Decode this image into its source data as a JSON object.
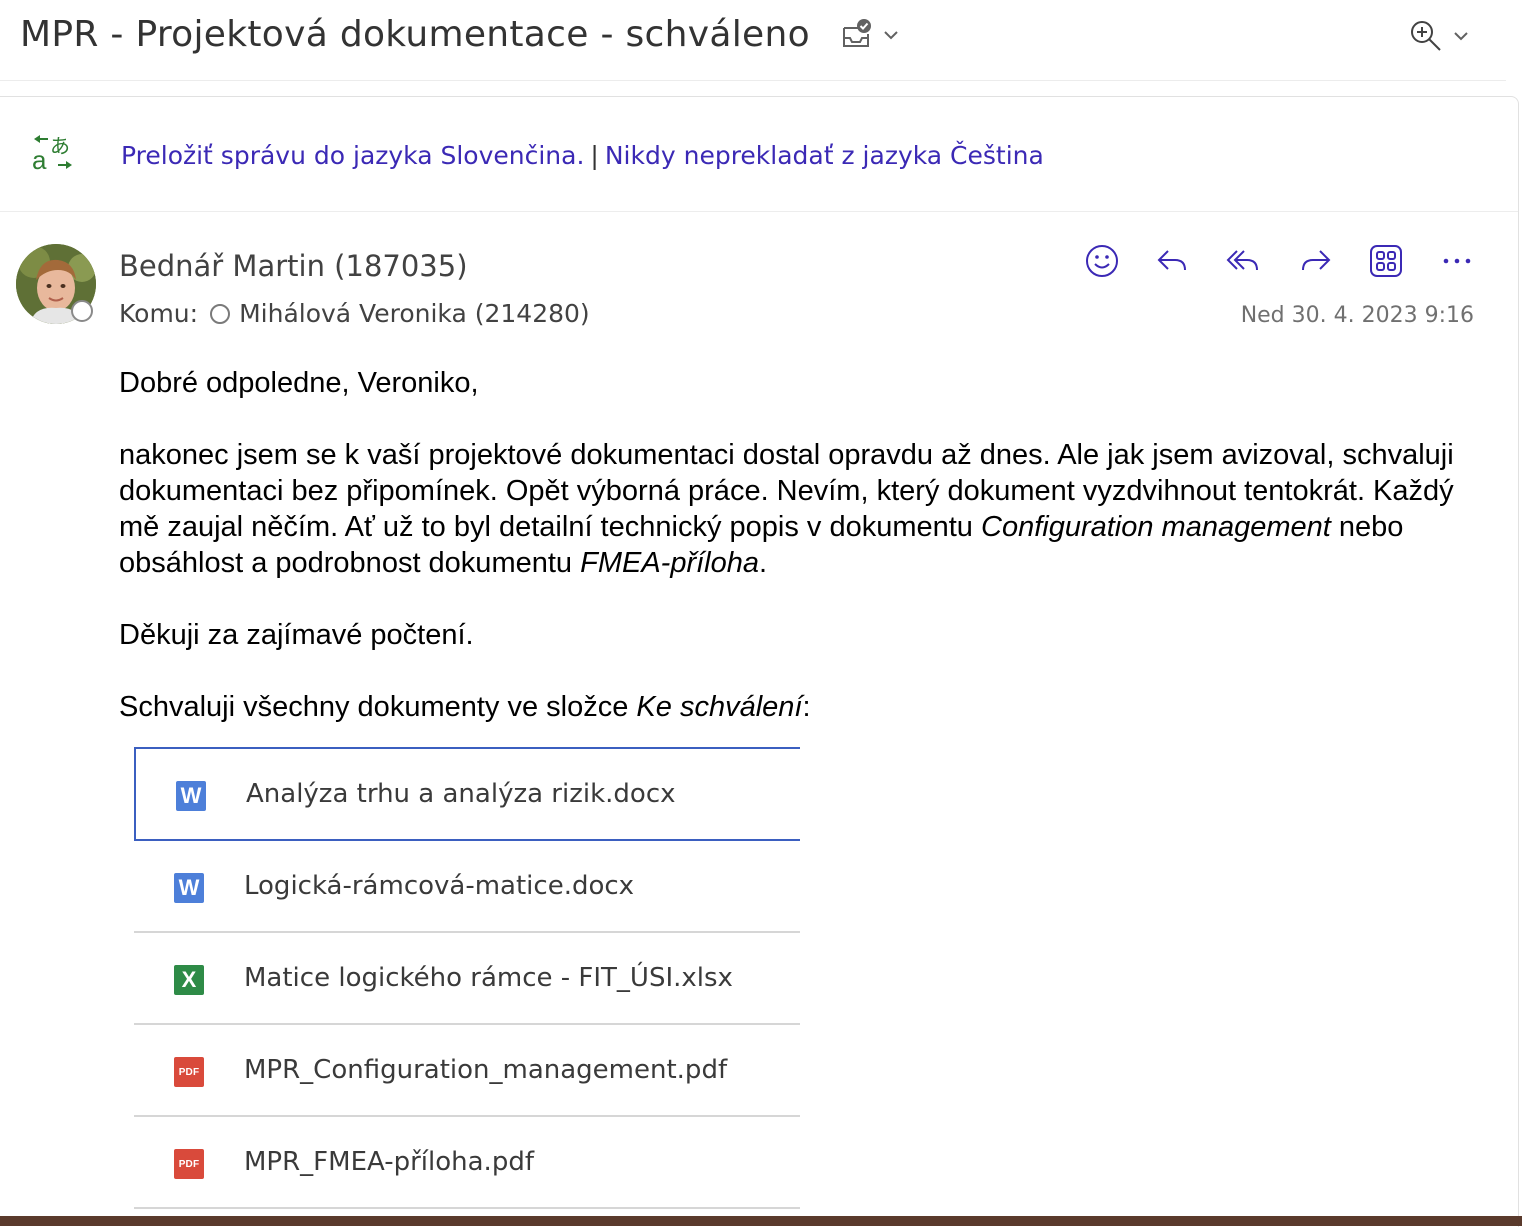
{
  "subject": "MPR - Projektová dokumentace - schváleno",
  "translate": {
    "translate_link": "Preložiť správu do jazyka Slovenčina.",
    "separator": "|",
    "never_link": "Nikdy neprekladať z jazyka Čeština"
  },
  "message": {
    "sender": "Bednář Martin (187035)",
    "to_label": "Komu:",
    "recipient": "Mihálová Veronika (214280)",
    "date": "Ned 30. 4. 2023 9:16",
    "greeting": "Dobré odpoledne, Veroniko,",
    "para1_a": "nakonec jsem se k vaší projektové dokumentaci dostal opravdu až dnes. Ale jak jsem avizoval, schvaluji dokumentaci bez připomínek. Opět výborná práce. Nevím, který dokument vyzdvihnout tentokrát. Každý mě zaujal něčím. Ať už to byl detailní technický popis v dokumentu ",
    "para1_em1": "Configuration management",
    "para1_b": " nebo obsáhlost a podrobnost dokumentu ",
    "para1_em2": "FMEA-příloha",
    "para1_c": ".",
    "thanks": "Děkuji za zajímavé počtení.",
    "approve_a": "Schvaluji všechny dokumenty ve složce ",
    "approve_em": "Ke schválení",
    "approve_b": ":"
  },
  "attachments": [
    {
      "name": "Analýza trhu a analýza rizik.docx",
      "type": "word",
      "badge": "W"
    },
    {
      "name": "Logická-rámcová-matice.docx",
      "type": "word",
      "badge": "W"
    },
    {
      "name": "Matice logického rámce - FIT_ÚSI.xlsx",
      "type": "excel",
      "badge": "X"
    },
    {
      "name": "MPR_Configuration_management.pdf",
      "type": "pdf",
      "badge": "PDF"
    },
    {
      "name": "MPR_FMEA-příloha.pdf",
      "type": "pdf",
      "badge": "PDF"
    }
  ],
  "icons": {
    "subject_tools": [
      "task-check-icon",
      "chevron-down-icon"
    ],
    "zoom_tools": [
      "zoom-in-icon",
      "chevron-down-icon"
    ],
    "actions": [
      "emoji-icon",
      "reply-icon",
      "reply-all-icon",
      "forward-icon",
      "apps-icon",
      "more-icon"
    ],
    "translate": "translate-icon"
  },
  "colors": {
    "link": "#3b29b5",
    "action_icon": "#3b29b5",
    "word": "#4d7fd9",
    "excel": "#2e8b47",
    "pdf": "#d94a3b",
    "selected_border": "#3b5fc0",
    "translate_icon": "#2e7d32"
  }
}
